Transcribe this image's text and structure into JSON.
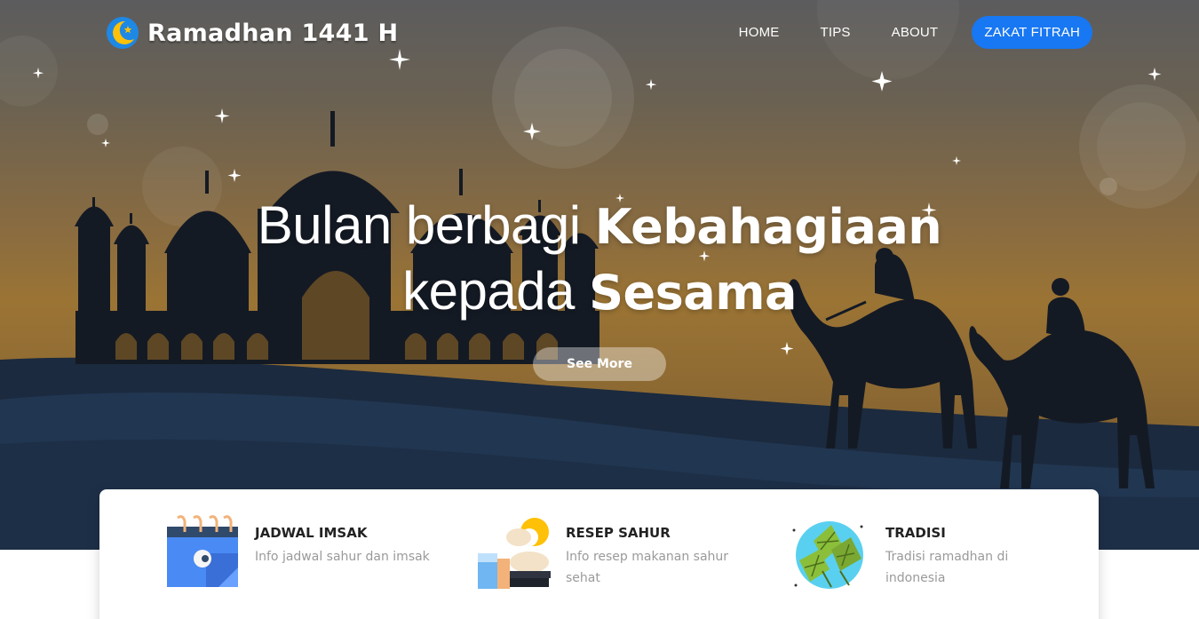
{
  "brand": {
    "title": "Ramadhan 1441 H"
  },
  "nav": {
    "items": [
      {
        "label": "HOME"
      },
      {
        "label": "TIPS"
      },
      {
        "label": "ABOUT"
      }
    ],
    "cta_label": "ZAKAT FITRAH"
  },
  "hero": {
    "line1_thin": "Bulan berbagi ",
    "line1_bold": "Kebahagiaan",
    "line2_thin": "kepada ",
    "line2_bold": "Sesama",
    "button_label": "See More"
  },
  "features": [
    {
      "title": "JADWAL IMSAK",
      "desc": "Info jadwal sahur dan imsak",
      "icon": "calendar-icon"
    },
    {
      "title": "RESEP SAHUR",
      "desc_line1": "Info resep makanan sahur",
      "desc_line2": "sehat",
      "icon": "meal-icon"
    },
    {
      "title": "TRADISI",
      "desc_line1": "Tradisi ramadhan di",
      "desc_line2": "indonesia",
      "icon": "ketupat-icon"
    }
  ],
  "colors": {
    "accent": "#1877f2",
    "hero_top": "#5c5c5e",
    "hero_mid": "#9b7434",
    "silhouette": "#141a24",
    "dune": "#1f3149"
  }
}
